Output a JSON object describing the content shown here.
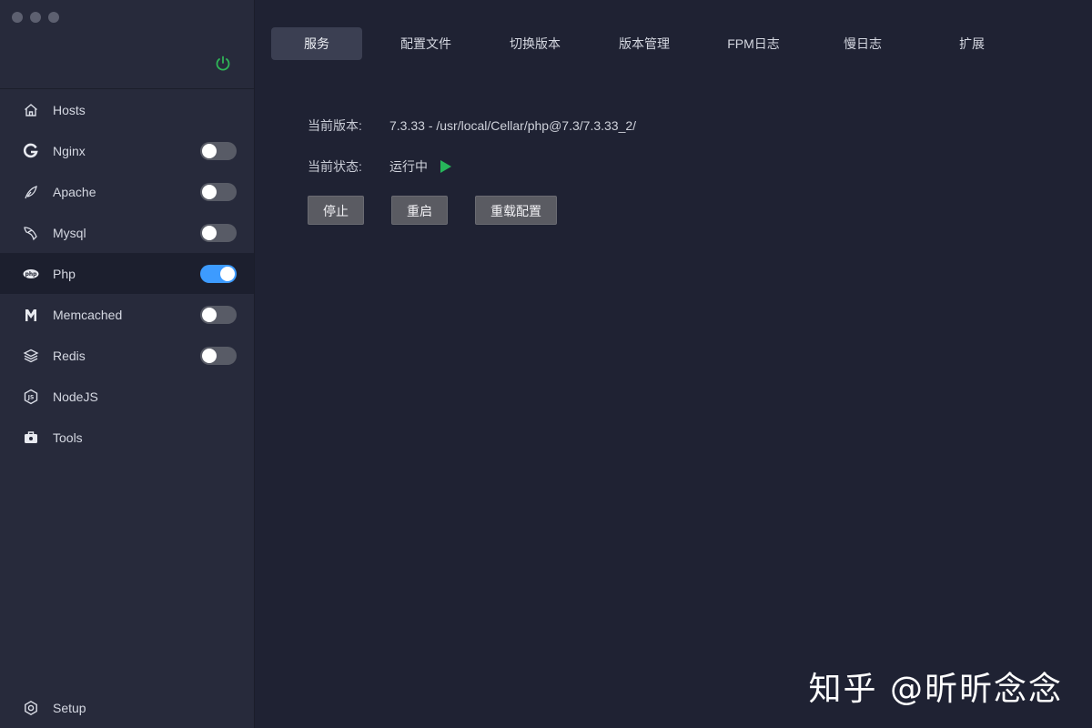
{
  "tabs": [
    "服务",
    "配置文件",
    "切换版本",
    "版本管理",
    "FPM日志",
    "慢日志",
    "扩展"
  ],
  "sidebar": {
    "items": [
      {
        "label": "Hosts",
        "icon": "home-icon",
        "toggle": null
      },
      {
        "label": "Nginx",
        "icon": "nginx-icon",
        "toggle": false
      },
      {
        "label": "Apache",
        "icon": "feather-icon",
        "toggle": false
      },
      {
        "label": "Mysql",
        "icon": "dolphin-icon",
        "toggle": false
      },
      {
        "label": "Php",
        "icon": "php-icon",
        "toggle": true,
        "active": true
      },
      {
        "label": "Memcached",
        "icon": "memcached-icon",
        "toggle": false
      },
      {
        "label": "Redis",
        "icon": "layers-icon",
        "toggle": false
      },
      {
        "label": "NodeJS",
        "icon": "nodejs-icon",
        "toggle": null
      },
      {
        "label": "Tools",
        "icon": "toolbox-icon",
        "toggle": null
      }
    ],
    "setup_label": "Setup"
  },
  "main": {
    "version_label": "当前版本:",
    "version_value": "7.3.33 - /usr/local/Cellar/php@7.3/7.3.33_2/",
    "status_label": "当前状态:",
    "status_value": "运行中",
    "buttons": {
      "stop": "停止",
      "restart": "重启",
      "reload": "重载配置"
    }
  },
  "watermark": "知乎 @昕昕念念",
  "colors": {
    "accent": "#3d9bff",
    "running": "#27b55a",
    "power": "#2fb557"
  }
}
